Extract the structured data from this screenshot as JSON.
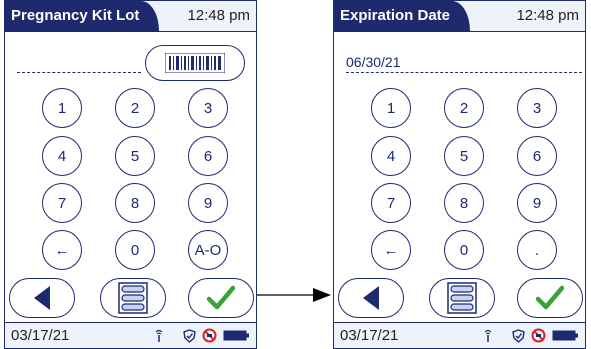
{
  "left_screen": {
    "title": "Pregnancy Kit Lot",
    "time": "12:48 pm",
    "entry_value": "",
    "keys": [
      "1",
      "2",
      "3",
      "4",
      "5",
      "6",
      "7",
      "8",
      "9",
      "←",
      "0",
      "A-O"
    ],
    "status_date": "03/17/21"
  },
  "right_screen": {
    "title": "Expiration Date",
    "time": "12:48 pm",
    "entry_value": "06/30/21",
    "keys": [
      "1",
      "2",
      "3",
      "4",
      "5",
      "6",
      "7",
      "8",
      "9",
      "←",
      "0",
      "."
    ],
    "status_date": "03/17/21"
  },
  "icons": {
    "barcode": "barcode-icon",
    "back": "back-triangle-icon",
    "menu": "list-menu-icon",
    "confirm": "checkmark-icon",
    "wireless": "wireless-icon",
    "shield": "shield-icon",
    "no_entry": "no-sign-icon",
    "battery": "battery-icon"
  },
  "colors": {
    "navy": "#1d2a6e",
    "check_green": "#3aa335",
    "no_sign_red": "#e02020"
  }
}
